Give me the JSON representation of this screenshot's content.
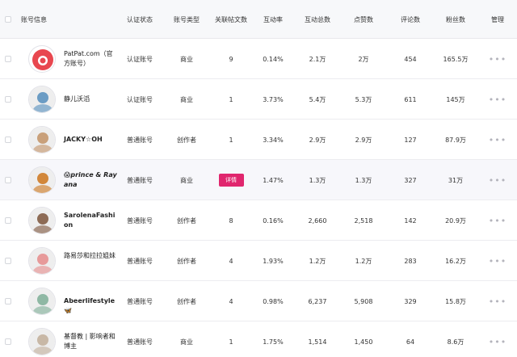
{
  "headers": {
    "account": "账号信息",
    "verify": "认证状态",
    "type": "账号类型",
    "posts": "关联帖文数",
    "rate": "互动率",
    "total": "互动总数",
    "likes": "点赞数",
    "comments": "评论数",
    "fans": "粉丝数",
    "manage": "管理"
  },
  "rows": [
    {
      "name": "PatPat.com（官方账号）",
      "verify": "认证账号",
      "type": "商业",
      "posts": "9",
      "rate": "0.14%",
      "total": "2.1万",
      "likes": "2万",
      "comments": "454",
      "fans": "165.5万",
      "manage": "•••",
      "avatar_color": "#e8474f"
    },
    {
      "name": "静儿沃滔",
      "verify": "认证账号",
      "type": "商业",
      "posts": "1",
      "rate": "3.73%",
      "total": "5.4万",
      "likes": "5.3万",
      "comments": "611",
      "fans": "145万",
      "manage": "•••",
      "avatar_color": "#6b9cc4"
    },
    {
      "name": "JACKY☆OH",
      "verify": "普通账号",
      "type": "创作者",
      "posts": "1",
      "rate": "3.34%",
      "total": "2.9万",
      "likes": "2.9万",
      "comments": "127",
      "fans": "87.9万",
      "manage": "•••",
      "avatar_color": "#c9a07a"
    },
    {
      "name": "😱prince & Rayana",
      "verify": "普通账号",
      "type": "商业",
      "posts": "详情",
      "rate": "1.47%",
      "total": "1.3万",
      "likes": "1.3万",
      "comments": "327",
      "fans": "31万",
      "manage": "•••",
      "avatar_color": "#d2873a"
    },
    {
      "name": "SarolenaFashion",
      "verify": "普通账号",
      "type": "创作者",
      "posts": "8",
      "rate": "0.16%",
      "total": "2,660",
      "likes": "2,518",
      "comments": "142",
      "fans": "20.9万",
      "manage": "•••",
      "avatar_color": "#8d6b55"
    },
    {
      "name": "路易莎和拉拉姐妹",
      "verify": "普通账号",
      "type": "创作者",
      "posts": "4",
      "rate": "1.93%",
      "total": "1.2万",
      "likes": "1.2万",
      "comments": "283",
      "fans": "16.2万",
      "manage": "•••",
      "avatar_color": "#e79a9a"
    },
    {
      "name": "Abeerlifestyle🦋",
      "verify": "普通账号",
      "type": "创作者",
      "posts": "4",
      "rate": "0.98%",
      "total": "6,237",
      "likes": "5,908",
      "comments": "329",
      "fans": "15.8万",
      "manage": "•••",
      "avatar_color": "#8fb8a4"
    },
    {
      "name": "基督教 | 影响者和博主",
      "verify": "普通账号",
      "type": "商业",
      "posts": "1",
      "rate": "1.75%",
      "total": "1,514",
      "likes": "1,450",
      "comments": "64",
      "fans": "8.6万",
      "manage": "•••",
      "avatar_color": "#c8b8a6"
    }
  ]
}
